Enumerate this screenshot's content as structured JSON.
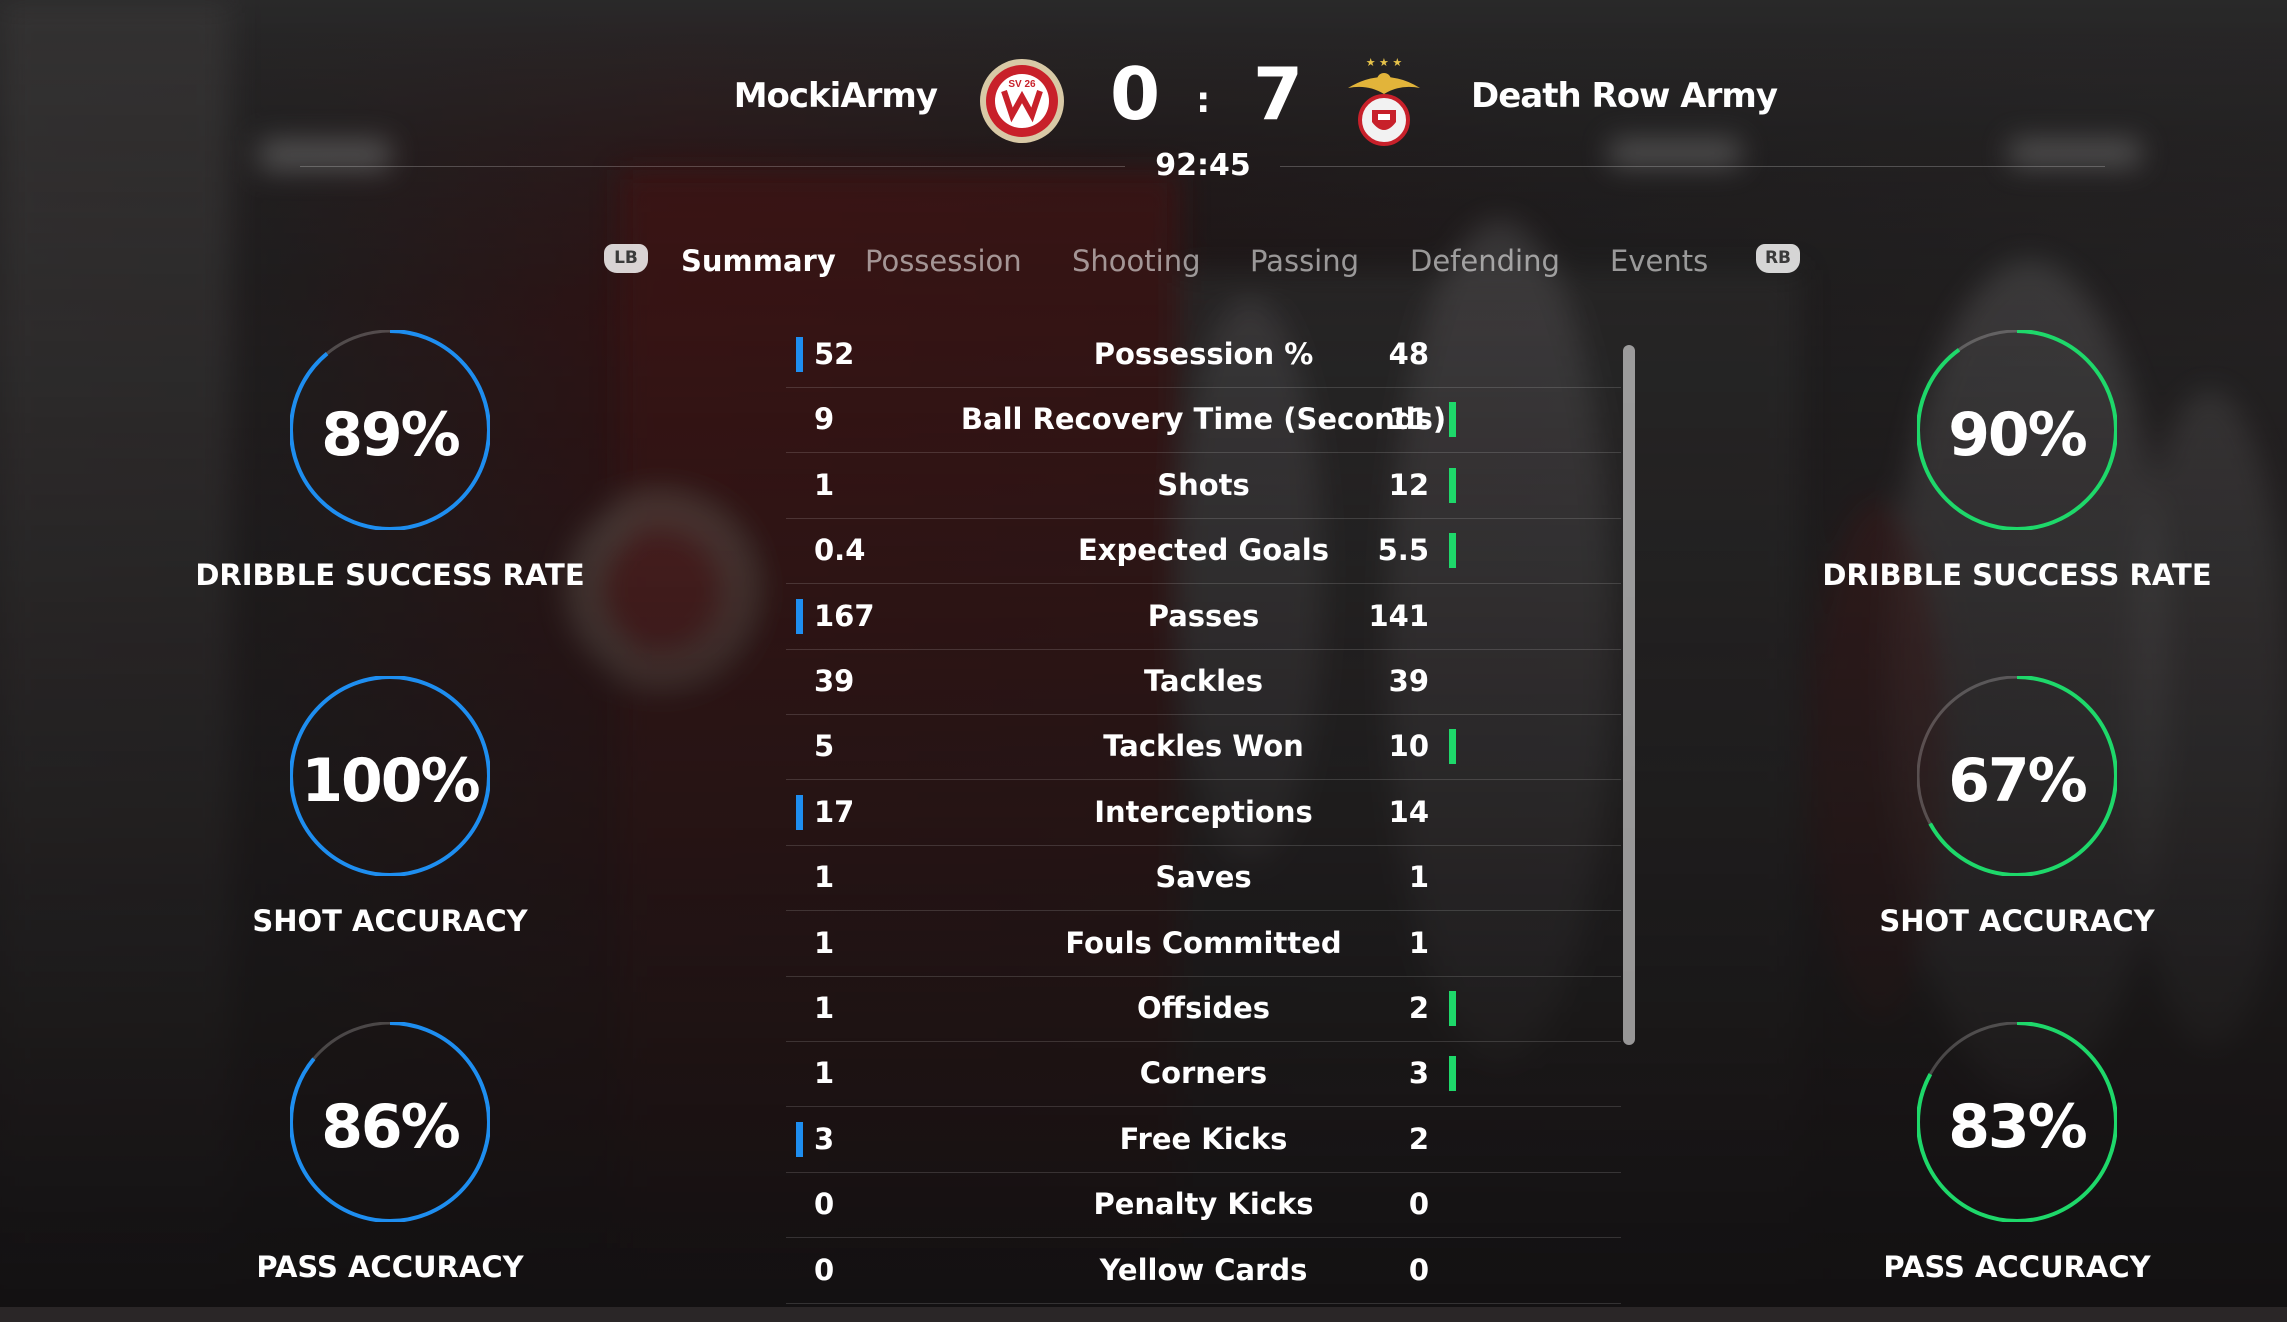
{
  "match": {
    "home_team": "MockiArmy",
    "away_team": "Death Row Army",
    "home_score": "0",
    "away_score": "7",
    "separator": ":",
    "clock": "92:45",
    "home_crest_text": "SV 26",
    "colors": {
      "home": "#1e8ef0",
      "away": "#1ed86a"
    }
  },
  "tabs": {
    "left_bumper": "LB",
    "right_bumper": "RB",
    "items": [
      {
        "label": "Summary",
        "active": true
      },
      {
        "label": "Possession",
        "active": false
      },
      {
        "label": "Shooting",
        "active": false
      },
      {
        "label": "Passing",
        "active": false
      },
      {
        "label": "Defending",
        "active": false
      },
      {
        "label": "Events",
        "active": false
      }
    ]
  },
  "stats": [
    {
      "label": "Possession %",
      "home": "52",
      "away": "48",
      "leader": "home"
    },
    {
      "label": "Ball Recovery Time (Seconds)",
      "home": "9",
      "away": "11",
      "leader": "away"
    },
    {
      "label": "Shots",
      "home": "1",
      "away": "12",
      "leader": "away"
    },
    {
      "label": "Expected Goals",
      "home": "0.4",
      "away": "5.5",
      "leader": "away"
    },
    {
      "label": "Passes",
      "home": "167",
      "away": "141",
      "leader": "home"
    },
    {
      "label": "Tackles",
      "home": "39",
      "away": "39",
      "leader": "none"
    },
    {
      "label": "Tackles Won",
      "home": "5",
      "away": "10",
      "leader": "away"
    },
    {
      "label": "Interceptions",
      "home": "17",
      "away": "14",
      "leader": "home"
    },
    {
      "label": "Saves",
      "home": "1",
      "away": "1",
      "leader": "none"
    },
    {
      "label": "Fouls Committed",
      "home": "1",
      "away": "1",
      "leader": "none"
    },
    {
      "label": "Offsides",
      "home": "1",
      "away": "2",
      "leader": "away"
    },
    {
      "label": "Corners",
      "home": "1",
      "away": "3",
      "leader": "away"
    },
    {
      "label": "Free Kicks",
      "home": "3",
      "away": "2",
      "leader": "home"
    },
    {
      "label": "Penalty Kicks",
      "home": "0",
      "away": "0",
      "leader": "none"
    },
    {
      "label": "Yellow Cards",
      "home": "0",
      "away": "0",
      "leader": "none"
    }
  ],
  "gauges": {
    "home": [
      {
        "value": "89%",
        "fraction": 0.89,
        "label": "DRIBBLE SUCCESS RATE"
      },
      {
        "value": "100%",
        "fraction": 1.0,
        "label": "SHOT ACCURACY"
      },
      {
        "value": "86%",
        "fraction": 0.86,
        "label": "PASS ACCURACY"
      }
    ],
    "away": [
      {
        "value": "90%",
        "fraction": 0.9,
        "label": "DRIBBLE SUCCESS RATE"
      },
      {
        "value": "67%",
        "fraction": 0.67,
        "label": "SHOT ACCURACY"
      },
      {
        "value": "83%",
        "fraction": 0.83,
        "label": "PASS ACCURACY"
      }
    ]
  }
}
